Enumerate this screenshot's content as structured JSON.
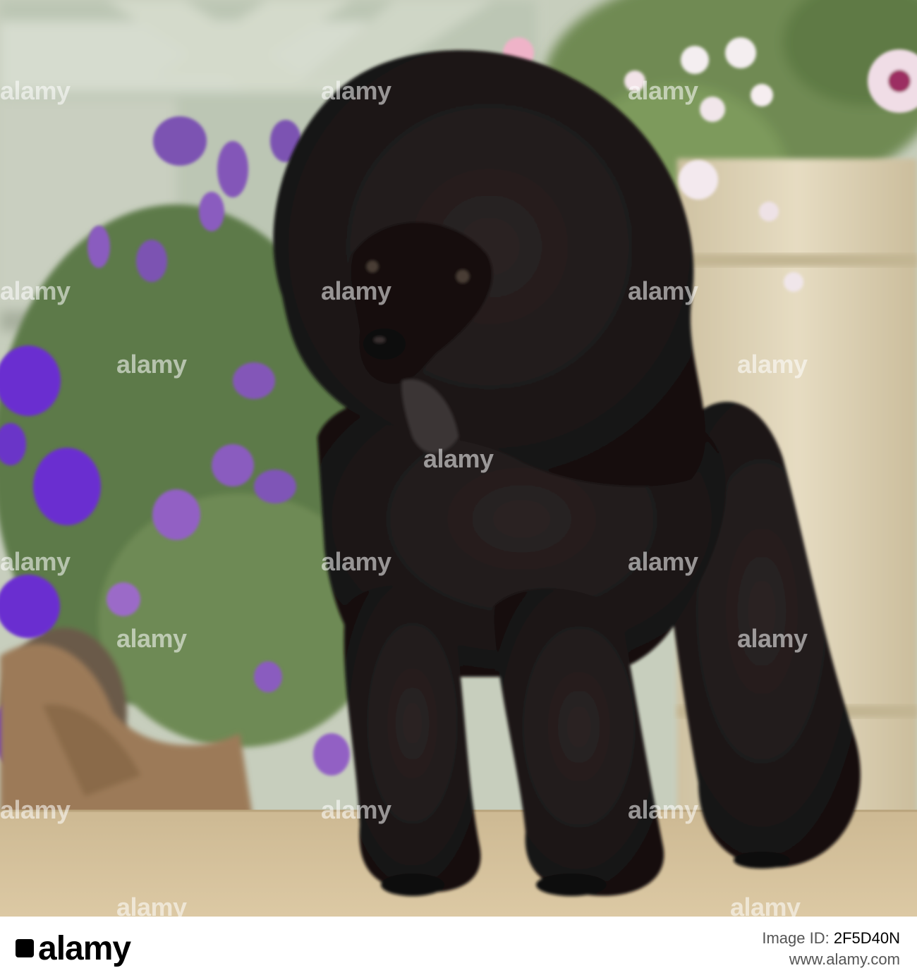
{
  "photo": {
    "subject": "black-poodle",
    "colors": {
      "fur": "#1c1717",
      "deck": "#d8c39c",
      "trellis": "#b8c4b0",
      "lavender": "#7a4fb5",
      "pot": "#ded3b8",
      "burlap": "#9c7a58"
    }
  },
  "watermarks": [
    "alamy",
    "alamy",
    "alamy",
    "alamy",
    "alamy",
    "alamy",
    "alamy",
    "alamy",
    "alamy",
    "alamy",
    "alamy",
    "alamy",
    "alamy",
    "alamy",
    "alamy",
    "alamy",
    "alamy",
    "alamy",
    "alamy"
  ],
  "footer": {
    "logo": "alamy",
    "image_id_label": "Image ID:",
    "image_id": "2F5D40N",
    "site": "www.alamy.com"
  }
}
